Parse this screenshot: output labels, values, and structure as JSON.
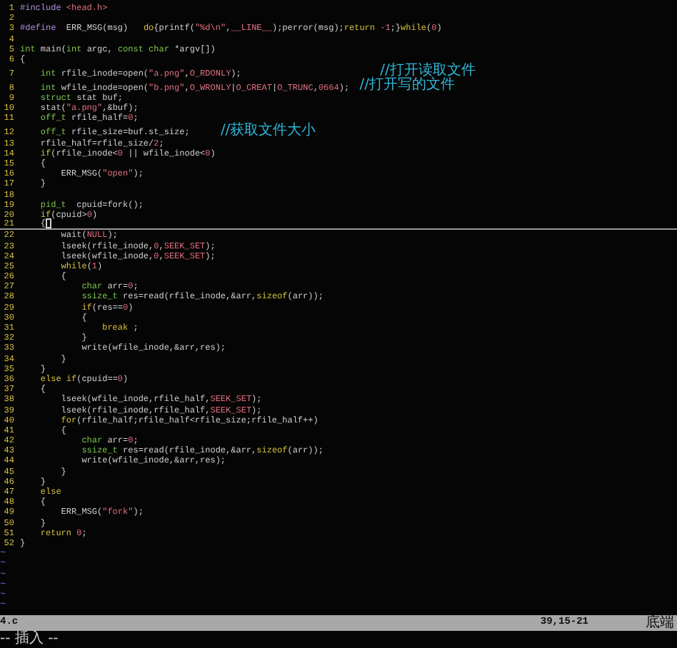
{
  "lines": [
    {
      "number": "1",
      "cursor": false,
      "segments": [
        {
          "kind": "preproc",
          "text": "#include "
        },
        {
          "kind": "string",
          "text": "<head.h>"
        }
      ]
    },
    {
      "number": "2",
      "cursor": false
    },
    {
      "number": "3",
      "cursor": false,
      "segments": [
        {
          "kind": "preproc",
          "text": "#define"
        },
        {
          "kind": "plain",
          "text": "  ERR_MSG(msg)   "
        },
        {
          "kind": "keyword",
          "text": "do"
        },
        {
          "kind": "plain",
          "text": "{printf("
        },
        {
          "kind": "string",
          "text": "\"%d\\n\""
        },
        {
          "kind": "plain",
          "text": ","
        },
        {
          "kind": "constant",
          "text": "__LINE__"
        },
        {
          "kind": "plain",
          "text": ");perror(msg);"
        },
        {
          "kind": "keyword",
          "text": "return "
        },
        {
          "kind": "number",
          "text": "-1"
        },
        {
          "kind": "plain",
          "text": ";}"
        },
        {
          "kind": "keyword",
          "text": "while"
        },
        {
          "kind": "plain",
          "text": "("
        },
        {
          "kind": "number",
          "text": "0"
        },
        {
          "kind": "plain",
          "text": ")"
        }
      ]
    },
    {
      "number": "4",
      "cursor": false
    },
    {
      "number": "5",
      "cursor": false,
      "segments": [
        {
          "kind": "type",
          "text": "int"
        },
        {
          "kind": "plain",
          "text": " main("
        },
        {
          "kind": "type",
          "text": "int"
        },
        {
          "kind": "plain",
          "text": " argc, "
        },
        {
          "kind": "type",
          "text": "const char"
        },
        {
          "kind": "plain",
          "text": " *argv[])"
        }
      ]
    },
    {
      "number": "6",
      "cursor": false,
      "segments": [
        {
          "kind": "plain",
          "text": "{"
        }
      ]
    },
    {
      "number": "7",
      "cursor": false,
      "segments": [
        {
          "kind": "type",
          "text": "    int"
        },
        {
          "kind": "plain",
          "text": " rfile_inode=open("
        },
        {
          "kind": "string",
          "text": "\"a.png\""
        },
        {
          "kind": "plain",
          "text": ","
        },
        {
          "kind": "constant",
          "text": "O_RDONLY"
        },
        {
          "kind": "plain",
          "text": ");                           "
        },
        {
          "kind": "comment",
          "text": "//打开读取文件"
        }
      ]
    },
    {
      "number": "8",
      "cursor": false,
      "segments": [
        {
          "kind": "type",
          "text": "    int"
        },
        {
          "kind": "plain",
          "text": " wfile_inode=open("
        },
        {
          "kind": "string",
          "text": "\"b.png\""
        },
        {
          "kind": "plain",
          "text": ","
        },
        {
          "kind": "constant",
          "text": "O_WRONLY"
        },
        {
          "kind": "plain",
          "text": "|"
        },
        {
          "kind": "constant",
          "text": "O_CREAT"
        },
        {
          "kind": "plain",
          "text": "|"
        },
        {
          "kind": "constant",
          "text": "O_TRUNC"
        },
        {
          "kind": "plain",
          "text": ","
        },
        {
          "kind": "number",
          "text": "0664"
        },
        {
          "kind": "plain",
          "text": ");  "
        },
        {
          "kind": "comment",
          "text": "//打开写的文件"
        }
      ]
    },
    {
      "number": "9",
      "cursor": false,
      "segments": [
        {
          "kind": "type",
          "text": "    struct"
        },
        {
          "kind": "plain",
          "text": " stat buf;"
        }
      ]
    },
    {
      "number": "10",
      "cursor": false,
      "segments": [
        {
          "kind": "plain",
          "text": "    stat("
        },
        {
          "kind": "string",
          "text": "\"a.png\""
        },
        {
          "kind": "plain",
          "text": ",&buf);"
        }
      ]
    },
    {
      "number": "11",
      "cursor": false,
      "segments": [
        {
          "kind": "type",
          "text": "    off_t"
        },
        {
          "kind": "plain",
          "text": " rfile_half="
        },
        {
          "kind": "number",
          "text": "0"
        },
        {
          "kind": "plain",
          "text": ";"
        }
      ]
    },
    {
      "number": "12",
      "cursor": false,
      "segments": [
        {
          "kind": "type",
          "text": "    off_t"
        },
        {
          "kind": "plain",
          "text": " rfile_size=buf.st_size;      "
        },
        {
          "kind": "comment",
          "text": "//获取文件大小"
        }
      ]
    },
    {
      "number": "13",
      "cursor": false,
      "segments": [
        {
          "kind": "plain",
          "text": "    rfile_half=rfile_size/"
        },
        {
          "kind": "number",
          "text": "2"
        },
        {
          "kind": "plain",
          "text": ";"
        }
      ]
    },
    {
      "number": "14",
      "cursor": false,
      "segments": [
        {
          "kind": "keyword",
          "text": "    if"
        },
        {
          "kind": "plain",
          "text": "(rfile_inode<"
        },
        {
          "kind": "number",
          "text": "0"
        },
        {
          "kind": "plain",
          "text": " || wfile_inode<"
        },
        {
          "kind": "number",
          "text": "0"
        },
        {
          "kind": "plain",
          "text": ")"
        }
      ]
    },
    {
      "number": "15",
      "cursor": false,
      "segments": [
        {
          "kind": "plain",
          "text": "    {"
        }
      ]
    },
    {
      "number": "16",
      "cursor": false,
      "segments": [
        {
          "kind": "plain",
          "text": "        ERR_MSG("
        },
        {
          "kind": "string",
          "text": "\"open\""
        },
        {
          "kind": "plain",
          "text": ");"
        }
      ]
    },
    {
      "number": "17",
      "cursor": false,
      "segments": [
        {
          "kind": "plain",
          "text": "    }"
        }
      ]
    },
    {
      "number": "18",
      "cursor": false
    },
    {
      "number": "19",
      "cursor": false,
      "segments": [
        {
          "kind": "type",
          "text": "    pid_t"
        },
        {
          "kind": "plain",
          "text": "  cpuid=fork();"
        }
      ]
    },
    {
      "number": "20",
      "cursor": false,
      "segments": [
        {
          "kind": "keyword",
          "text": "    if"
        },
        {
          "kind": "plain",
          "text": "(cpuid>"
        },
        {
          "kind": "number",
          "text": "0"
        },
        {
          "kind": "plain",
          "text": ")"
        }
      ]
    },
    {
      "number": "21",
      "cursor": true,
      "segments": [
        {
          "kind": "plain",
          "text": "    {"
        }
      ]
    },
    {
      "number": "22",
      "cursor": false,
      "segments": [
        {
          "kind": "plain",
          "text": "        wait("
        },
        {
          "kind": "constant",
          "text": "NULL"
        },
        {
          "kind": "plain",
          "text": ");"
        }
      ]
    },
    {
      "number": "23",
      "cursor": false,
      "segments": [
        {
          "kind": "plain",
          "text": "        lseek(rfile_inode,"
        },
        {
          "kind": "number",
          "text": "0"
        },
        {
          "kind": "plain",
          "text": ","
        },
        {
          "kind": "constant",
          "text": "SEEK_SET"
        },
        {
          "kind": "plain",
          "text": ");"
        }
      ]
    },
    {
      "number": "24",
      "cursor": false,
      "segments": [
        {
          "kind": "plain",
          "text": "        lseek(wfile_inode,"
        },
        {
          "kind": "number",
          "text": "0"
        },
        {
          "kind": "plain",
          "text": ","
        },
        {
          "kind": "constant",
          "text": "SEEK_SET"
        },
        {
          "kind": "plain",
          "text": ");"
        }
      ]
    },
    {
      "number": "25",
      "cursor": false,
      "segments": [
        {
          "kind": "keyword",
          "text": "        while"
        },
        {
          "kind": "plain",
          "text": "("
        },
        {
          "kind": "number",
          "text": "1"
        },
        {
          "kind": "plain",
          "text": ")"
        }
      ]
    },
    {
      "number": "26",
      "cursor": false,
      "segments": [
        {
          "kind": "plain",
          "text": "        {"
        }
      ]
    },
    {
      "number": "27",
      "cursor": false,
      "segments": [
        {
          "kind": "type",
          "text": "            char"
        },
        {
          "kind": "plain",
          "text": " arr="
        },
        {
          "kind": "number",
          "text": "0"
        },
        {
          "kind": "plain",
          "text": ";"
        }
      ]
    },
    {
      "number": "28",
      "cursor": false,
      "segments": [
        {
          "kind": "type",
          "text": "            ssize_t"
        },
        {
          "kind": "plain",
          "text": " res=read(rfile_inode,&arr,"
        },
        {
          "kind": "keyword",
          "text": "sizeof"
        },
        {
          "kind": "plain",
          "text": "(arr));"
        }
      ]
    },
    {
      "number": "29",
      "cursor": false,
      "segments": [
        {
          "kind": "keyword",
          "text": "            if"
        },
        {
          "kind": "plain",
          "text": "(res=="
        },
        {
          "kind": "number",
          "text": "0"
        },
        {
          "kind": "plain",
          "text": ")"
        }
      ]
    },
    {
      "number": "30",
      "cursor": false,
      "segments": [
        {
          "kind": "plain",
          "text": "            {"
        }
      ]
    },
    {
      "number": "31",
      "cursor": false,
      "segments": [
        {
          "kind": "keyword",
          "text": "                break"
        },
        {
          "kind": "plain",
          "text": " ;"
        }
      ]
    },
    {
      "number": "32",
      "cursor": false,
      "segments": [
        {
          "kind": "plain",
          "text": "            }"
        }
      ]
    },
    {
      "number": "33",
      "cursor": false,
      "segments": [
        {
          "kind": "plain",
          "text": "            write(wfile_inode,&arr,res);"
        }
      ]
    },
    {
      "number": "34",
      "cursor": false,
      "segments": [
        {
          "kind": "plain",
          "text": "        }"
        }
      ]
    },
    {
      "number": "35",
      "cursor": false,
      "segments": [
        {
          "kind": "plain",
          "text": "    }"
        }
      ]
    },
    {
      "number": "36",
      "cursor": false,
      "segments": [
        {
          "kind": "keyword",
          "text": "    else if"
        },
        {
          "kind": "plain",
          "text": "(cpuid=="
        },
        {
          "kind": "number",
          "text": "0"
        },
        {
          "kind": "plain",
          "text": ")"
        }
      ]
    },
    {
      "number": "37",
      "cursor": false,
      "segments": [
        {
          "kind": "plain",
          "text": "    {"
        }
      ]
    },
    {
      "number": "38",
      "cursor": false,
      "segments": [
        {
          "kind": "plain",
          "text": "        lseek(wfile_inode,rfile_half,"
        },
        {
          "kind": "constant",
          "text": "SEEK_SET"
        },
        {
          "kind": "plain",
          "text": ");"
        }
      ]
    },
    {
      "number": "39",
      "cursor": false,
      "segments": [
        {
          "kind": "plain",
          "text": "        lseek(rfile_inode,rfile_half,"
        },
        {
          "kind": "constant",
          "text": "SEEK_SET"
        },
        {
          "kind": "plain",
          "text": ");"
        }
      ]
    },
    {
      "number": "40",
      "cursor": false,
      "segments": [
        {
          "kind": "keyword",
          "text": "        for"
        },
        {
          "kind": "plain",
          "text": "(rfile_half;rfile_half<rfile_size;rfile_half++)"
        }
      ]
    },
    {
      "number": "41",
      "cursor": false,
      "segments": [
        {
          "kind": "plain",
          "text": "        {"
        }
      ]
    },
    {
      "number": "42",
      "cursor": false,
      "segments": [
        {
          "kind": "type",
          "text": "            char"
        },
        {
          "kind": "plain",
          "text": " arr="
        },
        {
          "kind": "number",
          "text": "0"
        },
        {
          "kind": "plain",
          "text": ";"
        }
      ]
    },
    {
      "number": "43",
      "cursor": false,
      "segments": [
        {
          "kind": "type",
          "text": "            ssize_t"
        },
        {
          "kind": "plain",
          "text": " res=read(rfile_inode,&arr,"
        },
        {
          "kind": "keyword",
          "text": "sizeof"
        },
        {
          "kind": "plain",
          "text": "(arr));"
        }
      ]
    },
    {
      "number": "44",
      "cursor": false,
      "segments": [
        {
          "kind": "plain",
          "text": "            write(wfile_inode,&arr,res);"
        }
      ]
    },
    {
      "number": "45",
      "cursor": false,
      "segments": [
        {
          "kind": "plain",
          "text": "        }"
        }
      ]
    },
    {
      "number": "46",
      "cursor": false,
      "segments": [
        {
          "kind": "plain",
          "text": "    }"
        }
      ]
    },
    {
      "number": "47",
      "cursor": false,
      "segments": [
        {
          "kind": "keyword",
          "text": "    else"
        }
      ]
    },
    {
      "number": "48",
      "cursor": false,
      "segments": [
        {
          "kind": "plain",
          "text": "    {"
        }
      ]
    },
    {
      "number": "49",
      "cursor": false,
      "segments": [
        {
          "kind": "plain",
          "text": "        ERR_MSG("
        },
        {
          "kind": "string",
          "text": "\"fork\""
        },
        {
          "kind": "plain",
          "text": ");"
        }
      ]
    },
    {
      "number": "50",
      "cursor": false,
      "segments": [
        {
          "kind": "plain",
          "text": "    }"
        }
      ]
    },
    {
      "number": "51",
      "cursor": false,
      "segments": [
        {
          "kind": "keyword",
          "text": "    return "
        },
        {
          "kind": "number",
          "text": "0"
        },
        {
          "kind": "plain",
          "text": ";"
        }
      ]
    },
    {
      "number": "52",
      "cursor": false,
      "segments": [
        {
          "kind": "plain",
          "text": "}"
        }
      ]
    }
  ],
  "empty_lines": [
    "~",
    "~",
    "~",
    "~",
    "~",
    "~"
  ],
  "status_bar": {
    "file_name": "4.c",
    "cursor_position": "39,15-21",
    "scroll_position": "底端"
  },
  "mode_line": "-- 插入 --"
}
